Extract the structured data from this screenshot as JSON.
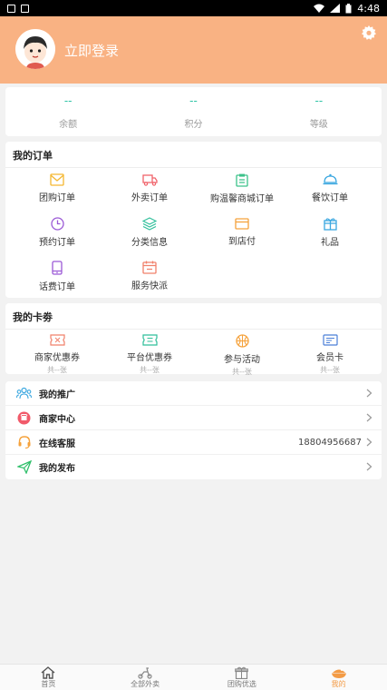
{
  "status_bar": {
    "time": "4:48"
  },
  "header": {
    "login_label": "立即登录"
  },
  "stats": [
    {
      "value": "--",
      "label": "余额"
    },
    {
      "value": "--",
      "label": "积分"
    },
    {
      "value": "--",
      "label": "等级"
    }
  ],
  "orders": {
    "title": "我的订单",
    "items": [
      {
        "label": "团购订单",
        "icon": "envelope-icon"
      },
      {
        "label": "外卖订单",
        "icon": "truck-icon"
      },
      {
        "label": "购温馨商城订单",
        "icon": "clipboard-icon"
      },
      {
        "label": "餐饮订单",
        "icon": "dish-cover-icon"
      },
      {
        "label": "预约订单",
        "icon": "clock-icon"
      },
      {
        "label": "分类信息",
        "icon": "layers-icon"
      },
      {
        "label": "到店付",
        "icon": "wallet-icon"
      },
      {
        "label": "礼品",
        "icon": "gift-icon"
      },
      {
        "label": "话费订单",
        "icon": "phone-icon"
      },
      {
        "label": "服务快派",
        "icon": "calendar-icon"
      }
    ]
  },
  "coupons": {
    "title": "我的卡劵",
    "items": [
      {
        "label": "商家优惠券",
        "sub": "共--张",
        "icon": "coupon-icon"
      },
      {
        "label": "平台优惠券",
        "sub": "共--张",
        "icon": "ticket-icon"
      },
      {
        "label": "参与活动",
        "sub": "共--张",
        "icon": "basketball-icon"
      },
      {
        "label": "会员卡",
        "sub": "共--张",
        "icon": "membership-card-icon"
      }
    ]
  },
  "menu": [
    {
      "label": "我的推广",
      "value": ""
    },
    {
      "label": "商家中心",
      "value": ""
    },
    {
      "label": "在线客服",
      "value": "18804956687"
    },
    {
      "label": "我的发布",
      "value": ""
    }
  ],
  "tabs": [
    {
      "label": "首页"
    },
    {
      "label": "全部外卖"
    },
    {
      "label": "团购优选"
    },
    {
      "label": "我的"
    }
  ],
  "colors": {
    "header_bg": "#f9b283",
    "accent": "#f39b45",
    "stat_value": "#2cc3a5"
  }
}
